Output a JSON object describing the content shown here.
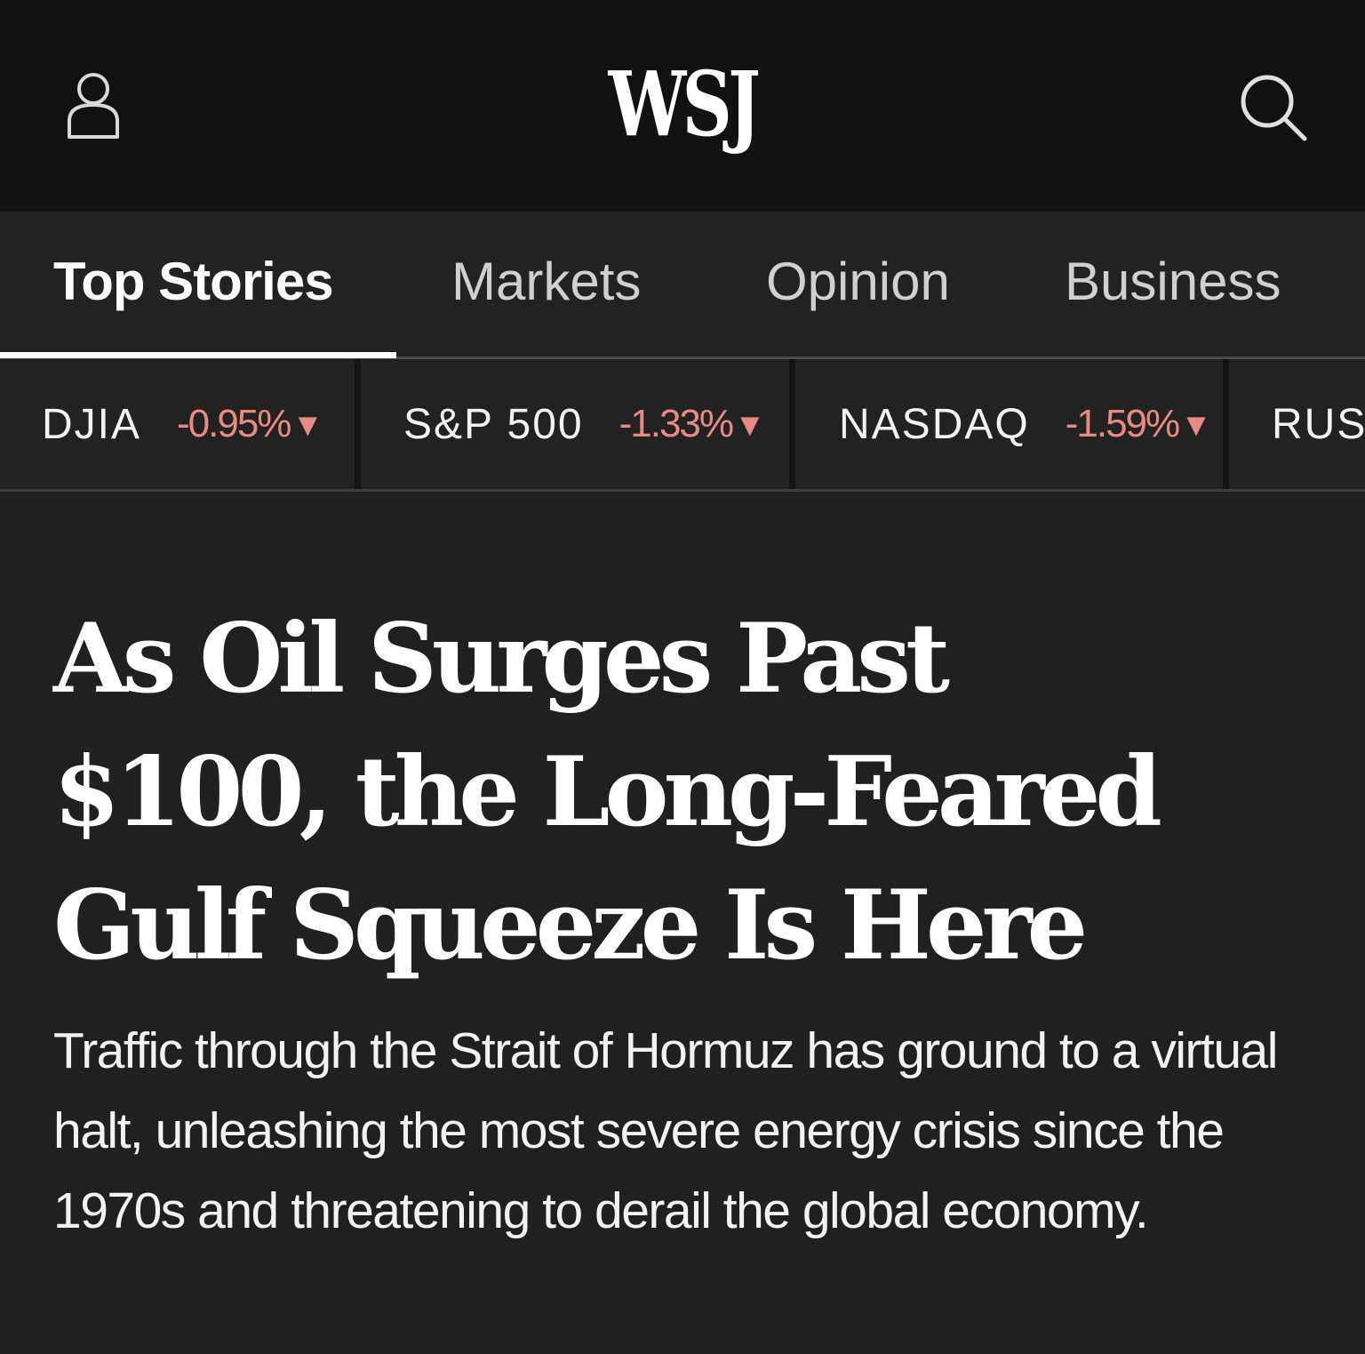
{
  "header": {
    "logo": "WSJ",
    "account_icon": "person-icon",
    "search_icon": "search-icon"
  },
  "tabs": [
    {
      "label": "Top Stories",
      "active": true
    },
    {
      "label": "Markets",
      "active": false
    },
    {
      "label": "Opinion",
      "active": false
    },
    {
      "label": "Business",
      "active": false
    }
  ],
  "ticker": [
    {
      "name": "DJIA",
      "change": "-0.95%",
      "direction": "down"
    },
    {
      "name": "S&P 500",
      "change": "-1.33%",
      "direction": "down"
    },
    {
      "name": "NASDAQ",
      "change": "-1.59%",
      "direction": "down"
    },
    {
      "name": "RUSS",
      "change": "",
      "direction": "down"
    }
  ],
  "ticker_arrow": "▼",
  "article": {
    "headline": "As Oil Surges Past $100, the Long-Feared Gulf Squeeze Is Here",
    "dek": "Traffic through the Strait of Hormuz has ground to a virtual halt, unleashing the most severe energy crisis since the 1970s and threatening to derail the global economy."
  },
  "colors": {
    "header_bg": "#111111",
    "page_bg": "#202020",
    "negative": "#e98a84",
    "text": "#ffffff"
  }
}
